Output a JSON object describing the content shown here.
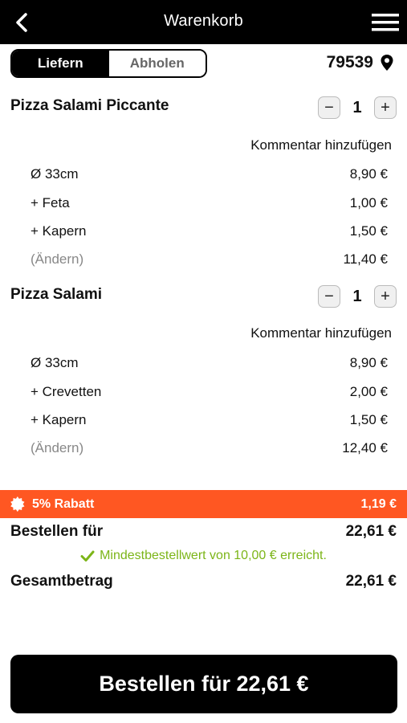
{
  "header": {
    "title": "Warenkorb",
    "back_icon": "chevron-left-icon",
    "menu_icon": "hamburger-menu-icon"
  },
  "delivery_toggle": {
    "options": [
      "Liefern",
      "Abholen"
    ],
    "selected": "Liefern"
  },
  "location": {
    "zip": "79539",
    "icon": "location-pin-icon"
  },
  "cart_items": [
    {
      "name": "Pizza Salami Piccante",
      "quantity": "1",
      "comment_label": "Kommentar hinzufügen",
      "lines": [
        {
          "label": "Ø 33cm",
          "price": "8,90 €"
        },
        {
          "label": "+ Feta",
          "price": "1,00 €"
        },
        {
          "label": "+ Kapern",
          "price": "1,50 €"
        }
      ],
      "edit_label": "(Ändern)",
      "total": "11,40 €"
    },
    {
      "name": "Pizza Salami",
      "quantity": "1",
      "comment_label": "Kommentar hinzufügen",
      "lines": [
        {
          "label": "Ø 33cm",
          "price": "8,90 €"
        },
        {
          "label": "+ Crevetten",
          "price": "2,00 €"
        },
        {
          "label": "+ Kapern",
          "price": "1,50 €"
        }
      ],
      "edit_label": "(Ändern)",
      "total": "12,40 €"
    }
  ],
  "discount": {
    "label": "5% Rabatt",
    "amount": "1,19 €",
    "icon": "badge-icon",
    "color": "#ff5722"
  },
  "summary": {
    "order_for_label": "Bestellen für",
    "order_for_value": "22,61 €",
    "min_order_note": "Mindestbestellwert von 10,00 € erreicht.",
    "min_note_color": "#7cb518",
    "total_label": "Gesamtbetrag",
    "total_value": "22,61 €"
  },
  "cta": {
    "label": "Bestellen für 22,61 €"
  },
  "stepper": {
    "minus": "−",
    "plus": "+"
  }
}
